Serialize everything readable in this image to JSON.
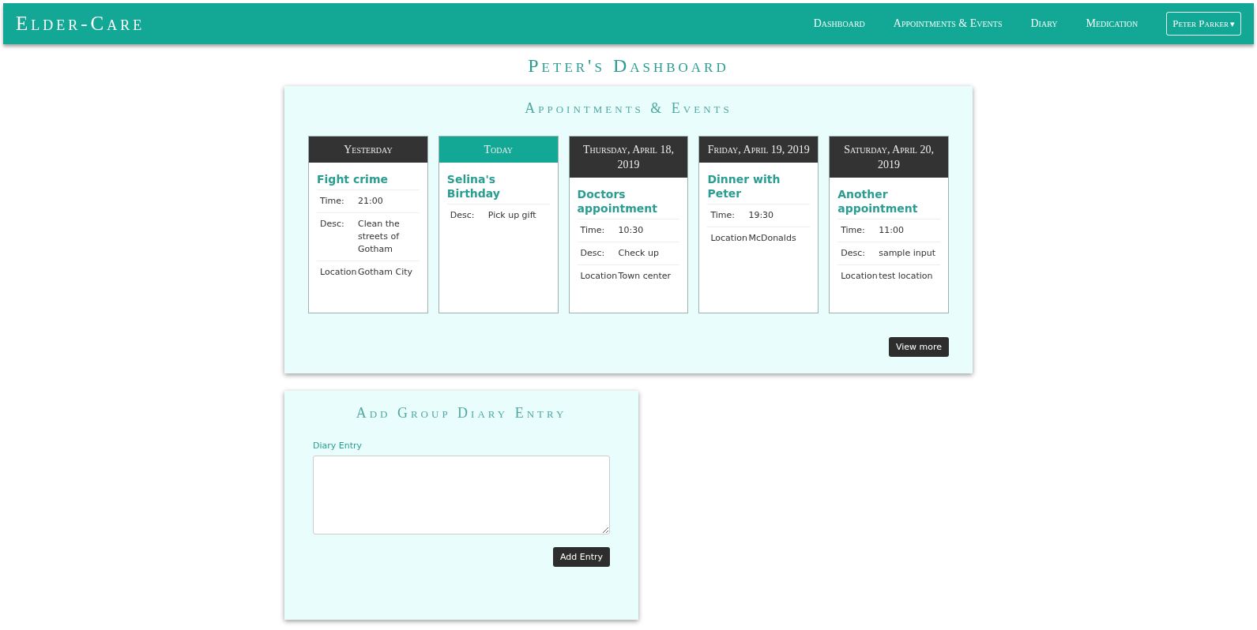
{
  "navbar": {
    "brand": "Elder-Care",
    "links": [
      "Dashboard",
      "Appointments & Events",
      "Diary",
      "Medication"
    ],
    "user_menu": {
      "label": "Peter Parker",
      "caret": "▾"
    }
  },
  "page_title": "Peter's Dashboard",
  "appointments": {
    "title": "Appointments & Events",
    "days": [
      {
        "heading": "Yesterday",
        "highlighted": false,
        "event": {
          "title": "Fight crime",
          "details": [
            {
              "label": "Time:",
              "value": "21:00"
            },
            {
              "label": "Desc:",
              "value": "Clean the streets of Gotham"
            },
            {
              "label": "Location",
              "value": "Gotham City"
            }
          ]
        }
      },
      {
        "heading": "Today",
        "highlighted": true,
        "event": {
          "title": "Selina's Birthday",
          "details": [
            {
              "label": "Desc:",
              "value": "Pick up gift"
            }
          ]
        }
      },
      {
        "heading": "Thursday, April 18, 2019",
        "highlighted": false,
        "event": {
          "title": "Doctors appointment",
          "details": [
            {
              "label": "Time:",
              "value": "10:30"
            },
            {
              "label": "Desc:",
              "value": "Check up"
            },
            {
              "label": "Location",
              "value": "Town center"
            }
          ]
        }
      },
      {
        "heading": "Friday, April 19, 2019",
        "highlighted": false,
        "event": {
          "title": "Dinner with Peter",
          "details": [
            {
              "label": "Time:",
              "value": "19:30"
            },
            {
              "label": "Location",
              "value": "McDonalds"
            }
          ]
        }
      },
      {
        "heading": "Saturday, April 20, 2019",
        "highlighted": false,
        "event": {
          "title": "Another appointment",
          "details": [
            {
              "label": "Time:",
              "value": "11:00"
            },
            {
              "label": "Desc:",
              "value": "sample input"
            },
            {
              "label": "Location",
              "value": "test location"
            }
          ]
        }
      }
    ],
    "view_more": "View more"
  },
  "diary": {
    "title": "Add Group Diary Entry",
    "field_label": "Diary Entry",
    "submit": "Add Entry"
  }
}
